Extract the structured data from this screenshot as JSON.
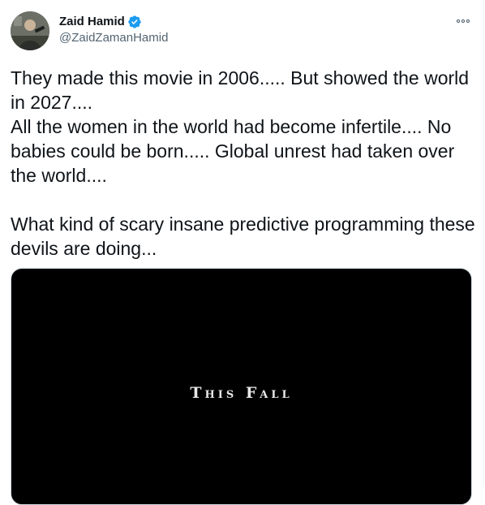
{
  "author": {
    "display_name": "Zaid Hamid",
    "handle": "@ZaidZamanHamid",
    "verified": true
  },
  "tweet": {
    "text": "They made this movie in 2006..... But showed the world in 2027....\nAll the women in the world had become infertile.... No babies could be born..... Global unrest had taken over the world....\n\nWhat kind of scary insane predictive programming these devils are doing..."
  },
  "media": {
    "caption": "This Fall"
  },
  "icons": {
    "verified": "verified-badge-icon",
    "more": "more-options-icon"
  },
  "colors": {
    "verified": "#1d9bf0",
    "text": "#0f1419",
    "secondary": "#536471"
  }
}
